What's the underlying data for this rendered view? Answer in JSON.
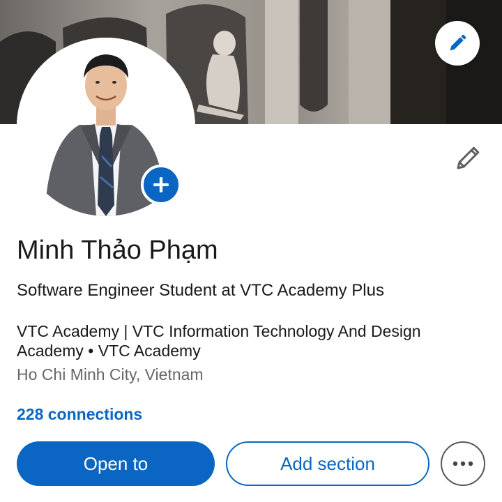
{
  "profile": {
    "name": "Minh Thảo Phạm",
    "headline": "Software Engineer Student at VTC Academy Plus",
    "education": "VTC Academy | VTC Information Technology And Design Academy • VTC Academy",
    "location": "Ho Chi Minh City, Vietnam",
    "connections": "228 connections"
  },
  "actions": {
    "open_to_label": "Open to",
    "add_section_label": "Add section",
    "more_icon": "more-horizontal-icon"
  },
  "icons": {
    "cover_edit": "pencil-icon",
    "intro_edit": "pencil-outline-icon",
    "avatar_add": "plus-icon"
  },
  "colors": {
    "brand": "#0a66c2",
    "text_primary": "#191919",
    "text_secondary": "#666666"
  }
}
